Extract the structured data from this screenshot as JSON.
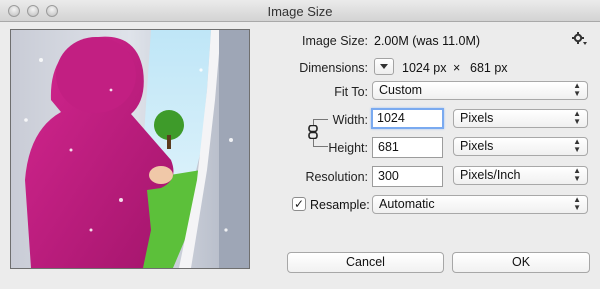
{
  "window": {
    "title": "Image Size"
  },
  "preview": {
    "alt": "preview of child in pink hooded coat peeking through torn paper"
  },
  "info": {
    "image_size_label": "Image Size:",
    "image_size_value": "2.00M (was 11.0M)",
    "dimensions_label": "Dimensions:",
    "dimensions_width": "1024 px",
    "dimensions_times": "×",
    "dimensions_height": "681 px"
  },
  "fit_to": {
    "label": "Fit To:",
    "value": "Custom"
  },
  "width": {
    "label": "Width:",
    "value": "1024",
    "unit": "Pixels"
  },
  "height": {
    "label": "Height:",
    "value": "681",
    "unit": "Pixels"
  },
  "resolution": {
    "label": "Resolution:",
    "value": "300",
    "unit": "Pixels/Inch"
  },
  "resample": {
    "label": "Resample:",
    "checked": true,
    "check_glyph": "✓",
    "value": "Automatic"
  },
  "buttons": {
    "cancel": "Cancel",
    "ok": "OK"
  },
  "icons": {
    "settings": "gear-icon",
    "link": "chain-link-icon",
    "dimensions_menu": "triangle-down-icon"
  }
}
